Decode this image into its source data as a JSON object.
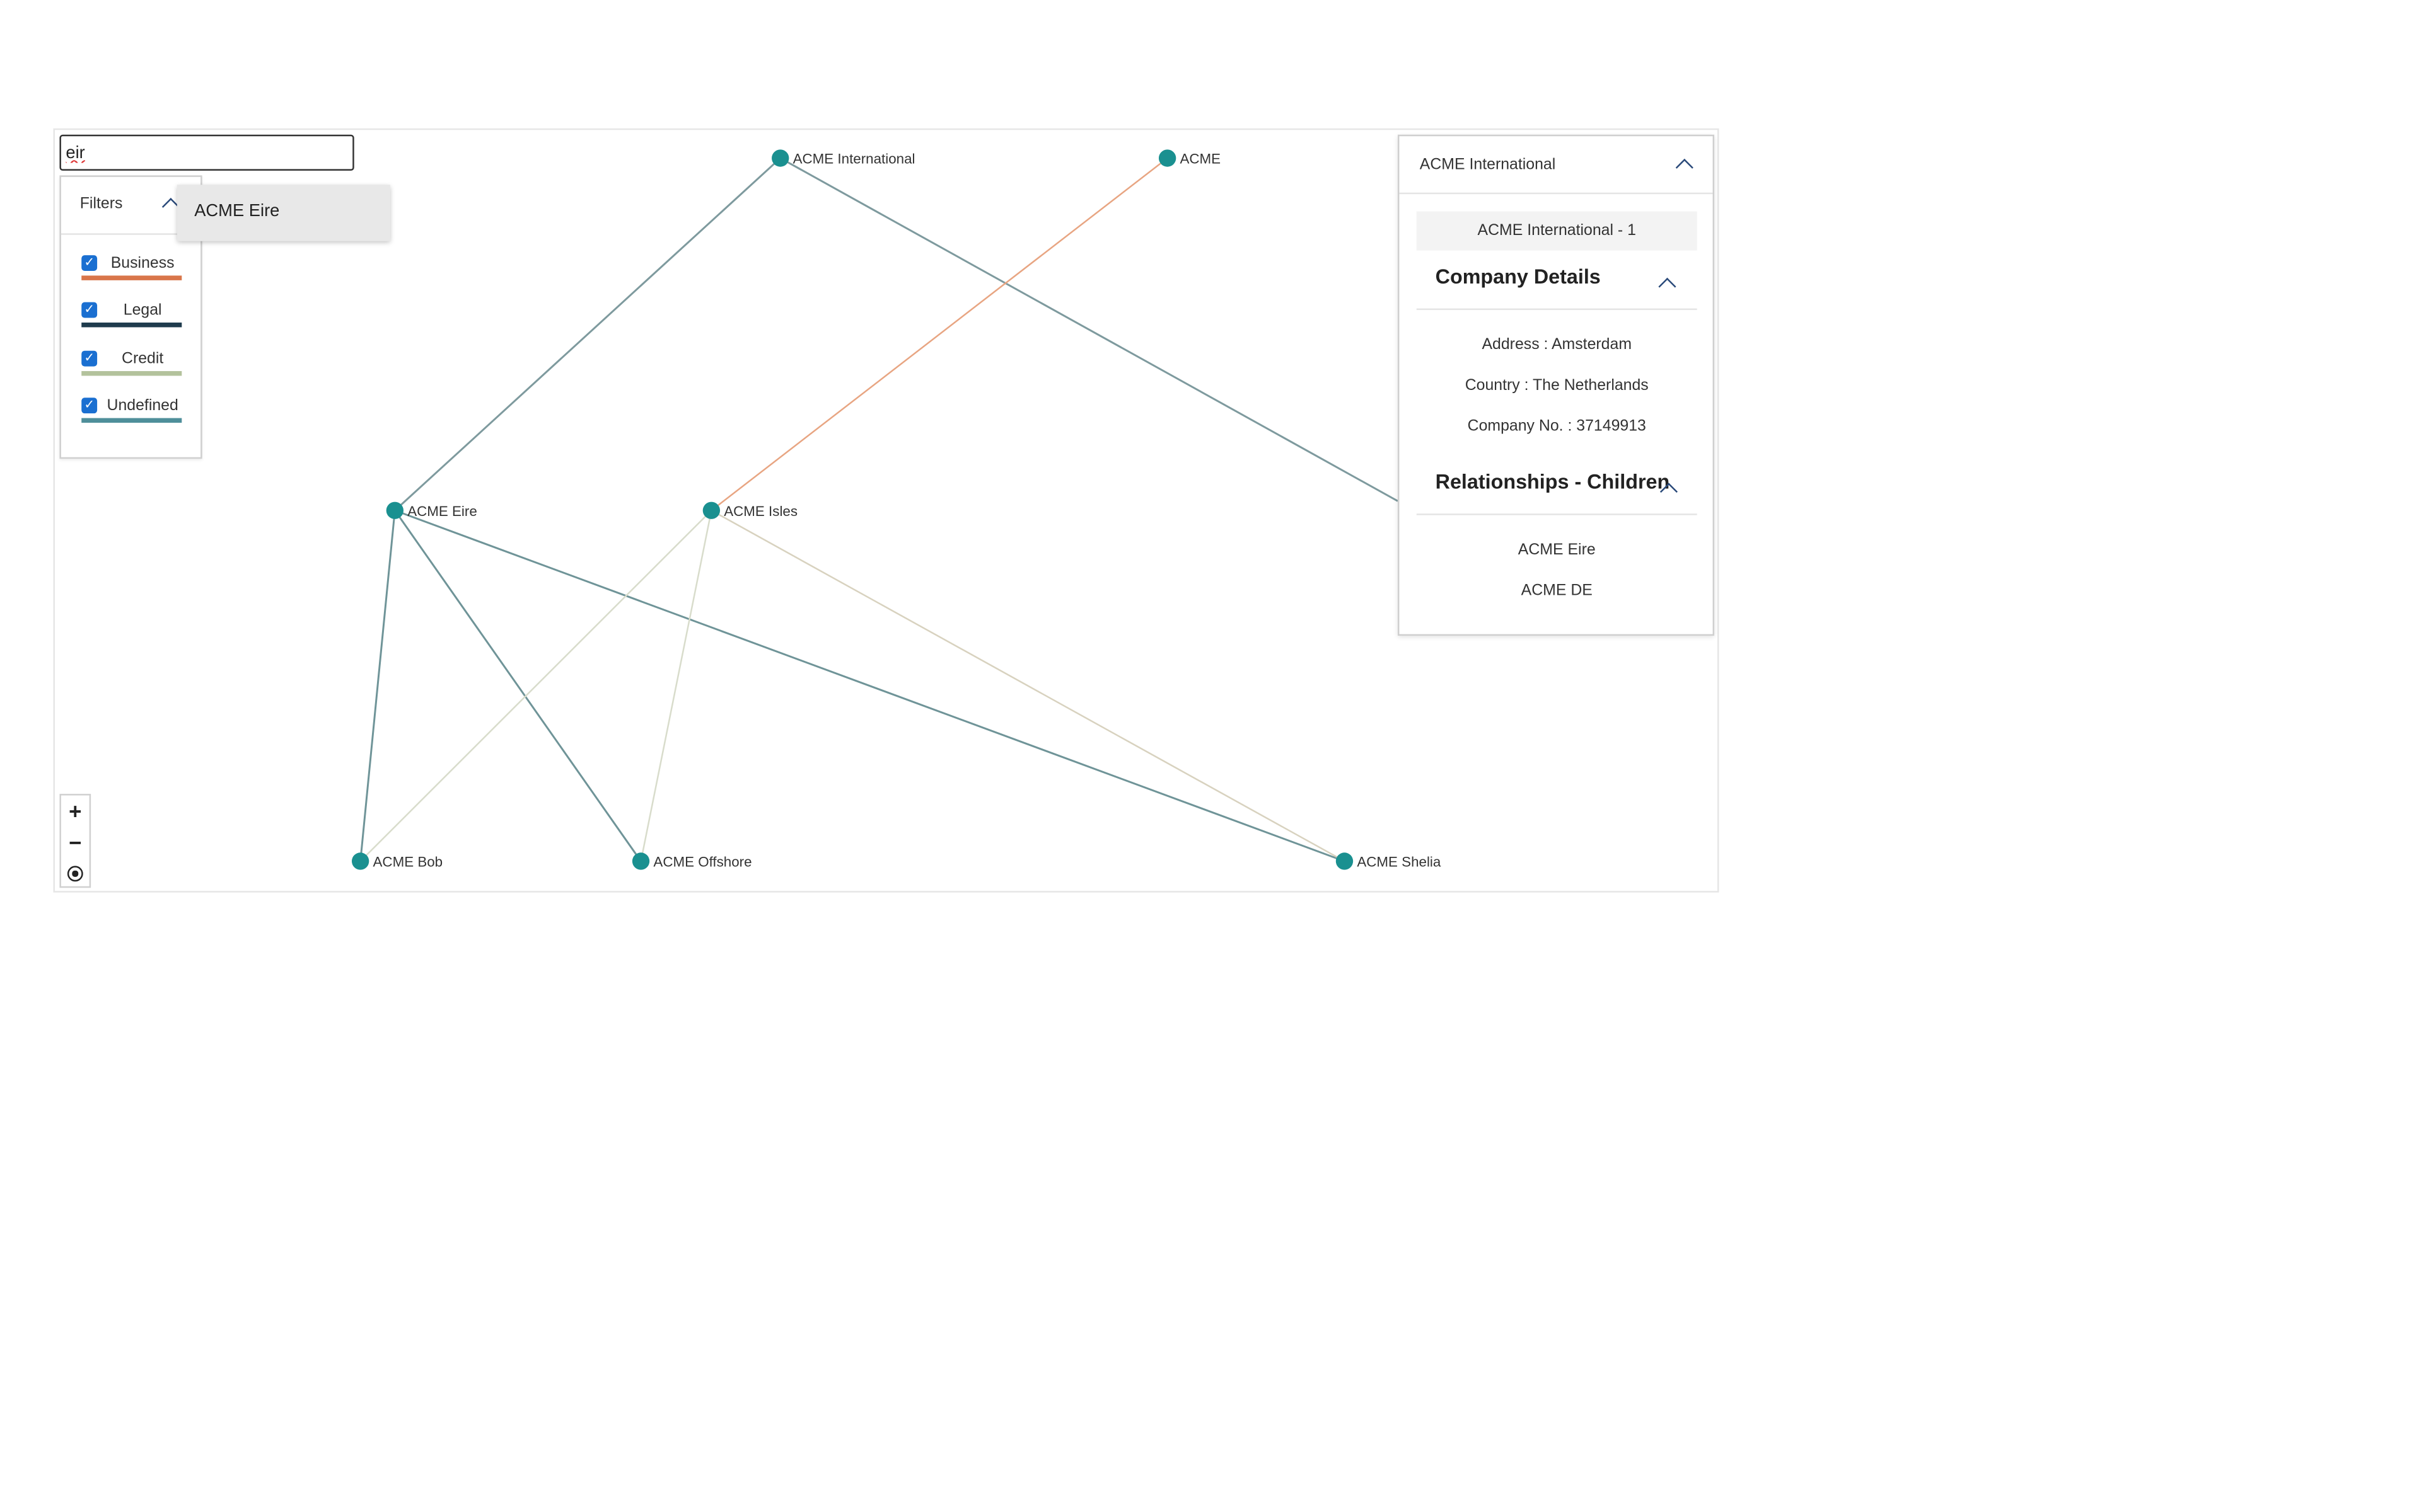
{
  "search": {
    "value": "eir",
    "suggestions": [
      "ACME Eire"
    ]
  },
  "filters": {
    "title": "Filters",
    "items": [
      {
        "label": "Business",
        "color": "#d9764a",
        "checked": true
      },
      {
        "label": "Legal",
        "color": "#1f3b4d",
        "checked": true
      },
      {
        "label": "Credit",
        "color": "#b3c29c",
        "checked": true
      },
      {
        "label": "Undefined",
        "color": "#4f8f9a",
        "checked": true
      }
    ]
  },
  "graph": {
    "node_color": "#1a9090",
    "nodes": [
      {
        "id": "intl",
        "label": "ACME International"
      },
      {
        "id": "acme",
        "label": "ACME"
      },
      {
        "id": "eire",
        "label": "ACME Eire"
      },
      {
        "id": "isles",
        "label": "ACME Isles"
      },
      {
        "id": "bob",
        "label": "ACME Bob"
      },
      {
        "id": "offshore",
        "label": "ACME Offshore"
      },
      {
        "id": "shelia",
        "label": "ACME Shelia"
      }
    ]
  },
  "zoom": {
    "in_label": "+",
    "out_label": "−"
  },
  "details": {
    "header": "ACME International",
    "entity": "ACME International - 1",
    "company_details_title": "Company Details",
    "address": "Address : Amsterdam",
    "country": "Country : The Netherlands",
    "company_no": "Company No. : 37149913",
    "relationships_title": "Relationships - Children",
    "children": [
      "ACME Eire",
      "ACME DE"
    ]
  }
}
